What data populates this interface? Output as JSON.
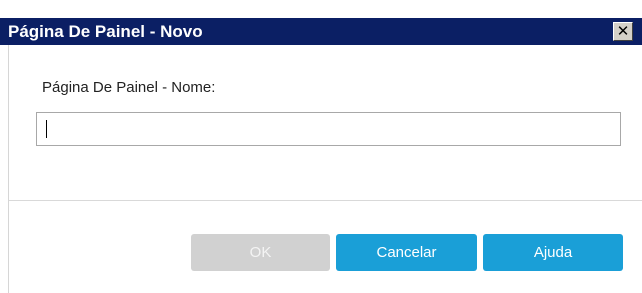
{
  "window": {
    "title": "Página De Painel - Novo",
    "close_glyph": "✕",
    "close_icon": "close-icon"
  },
  "form": {
    "name_label": "Página De Painel - Nome:",
    "name_value": "",
    "name_placeholder": ""
  },
  "buttons": {
    "ok_label": "OK",
    "ok_enabled": false,
    "cancel_label": "Cancelar",
    "help_label": "Ajuda"
  },
  "colors": {
    "titlebar": "#0b1f64",
    "primary_button": "#1a9fd7",
    "disabled_button": "#d1d1d1"
  }
}
